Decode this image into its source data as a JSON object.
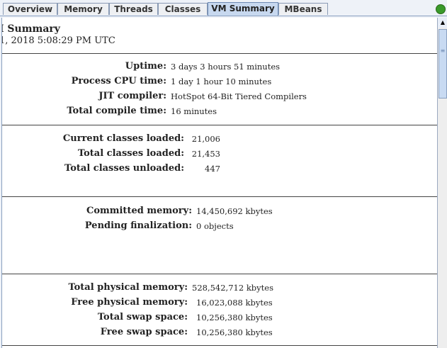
{
  "tabs": [
    "Overview",
    "Memory",
    "Threads",
    "Classes",
    "VM Summary",
    "MBeans"
  ],
  "header": {
    "title": "I Summary",
    "date": "1, 2018 5:08:29 PM UTC"
  },
  "vm": [
    {
      "label": "Uptime:",
      "value": "3 days 3 hours 51 minutes"
    },
    {
      "label": "Process CPU time:",
      "value": "1 day 1 hour 10 minutes"
    },
    {
      "label": "JIT compiler:",
      "value": "HotSpot 64-Bit Tiered Compilers"
    },
    {
      "label": "Total compile time:",
      "value": "16 minutes"
    }
  ],
  "classes": [
    {
      "label": "Current classes loaded:",
      "value": "21,006"
    },
    {
      "label": "Total classes loaded:",
      "value": "21,453"
    },
    {
      "label": "Total classes unloaded:",
      "value": "447"
    }
  ],
  "heap": [
    {
      "label": "Committed memory:",
      "value": "14,450,692 kbytes"
    },
    {
      "label": "Pending finalization:",
      "value": "0 objects"
    }
  ],
  "memory": [
    {
      "label": "Total physical memory:",
      "value": "528,542,712 kbytes"
    },
    {
      "label": "Free physical memory:",
      "value": "16,023,088 kbytes"
    },
    {
      "label": "Total swap space:",
      "value": "10,256,380 kbytes"
    },
    {
      "label": "Free swap space:",
      "value": "10,256,380 kbytes"
    }
  ]
}
